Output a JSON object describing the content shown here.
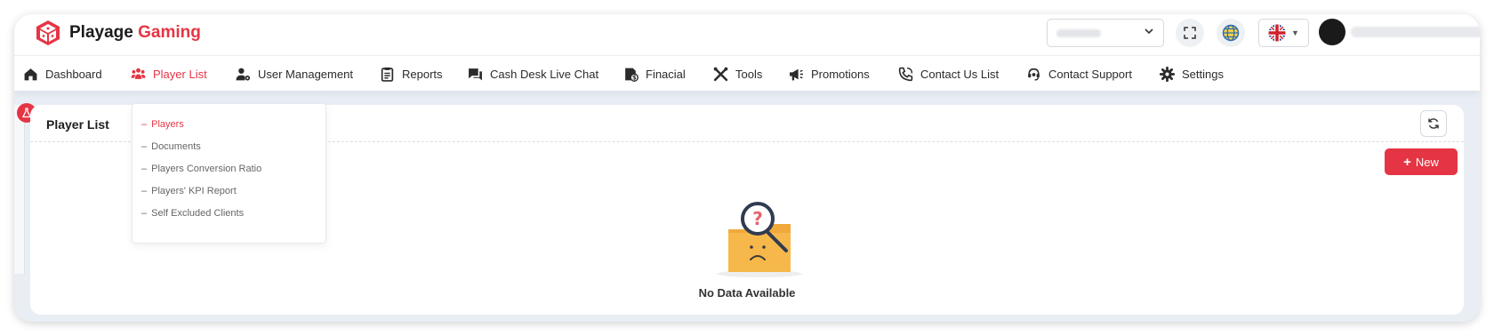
{
  "brand": {
    "name_part1": "Playage",
    "name_part2": "Gaming",
    "accent": "#e53544"
  },
  "header": {
    "language": "en-GB",
    "fullscreen_icon": "fullscreen-icon",
    "globe_icon": "globe-icon"
  },
  "nav": {
    "items": [
      {
        "label": "Dashboard",
        "icon": "home-icon"
      },
      {
        "label": "Player List",
        "icon": "users-icon",
        "active": true
      },
      {
        "label": "User Management",
        "icon": "user-gear-icon"
      },
      {
        "label": "Reports",
        "icon": "clipboard-icon"
      },
      {
        "label": "Cash Desk Live Chat",
        "icon": "chat-icon"
      },
      {
        "label": "Finacial",
        "icon": "finance-icon"
      },
      {
        "label": "Tools",
        "icon": "tools-icon"
      },
      {
        "label": "Promotions",
        "icon": "megaphone-icon"
      },
      {
        "label": "Contact Us List",
        "icon": "phone-icon"
      },
      {
        "label": "Contact Support",
        "icon": "headset-icon"
      },
      {
        "label": "Settings",
        "icon": "gear-icon"
      }
    ]
  },
  "dropdown": {
    "items": [
      {
        "label": "Players",
        "active": true
      },
      {
        "label": "Documents"
      },
      {
        "label": "Players Conversion Ratio"
      },
      {
        "label": "Players' KPI Report"
      },
      {
        "label": "Self Excluded Clients"
      }
    ]
  },
  "page": {
    "title": "Player List",
    "new_button": "New",
    "empty_text": "No Data Available"
  }
}
